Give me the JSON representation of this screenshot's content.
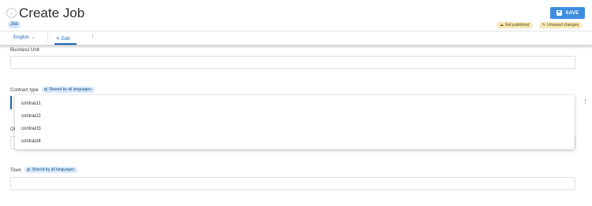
{
  "header": {
    "title": "Create Job",
    "type_badge": "Job",
    "save_label": "SAVE",
    "badges": {
      "not_published": "Not published",
      "unsaved_changes": "Unsaved changes"
    }
  },
  "tabbar": {
    "language": "English",
    "edit_tab": "Edit"
  },
  "form": {
    "business_unit_label": "Business Unit",
    "contract_type_label": "Contract type",
    "shared_badge": "Shared by all languages",
    "occluded_label_fragment": "Ot",
    "town_label": "Town"
  },
  "dropdown": {
    "options": [
      "contract1",
      "contract2",
      "contract3",
      "contract4"
    ]
  },
  "icons": {
    "back": "back-arrow-icon",
    "save": "floppy-disk-icon",
    "not_published": "cloud-off-icon",
    "unsaved": "pencil-icon",
    "language": "chevron-down-icon",
    "edit": "pencil-icon",
    "more": "more-vertical-icon",
    "shared": "globe-icon"
  },
  "colors": {
    "accent": "#3d8ee0",
    "link": "#1d63b0",
    "status_badge": "#f7e7b6",
    "shared_badge": "#d7e9fb"
  }
}
